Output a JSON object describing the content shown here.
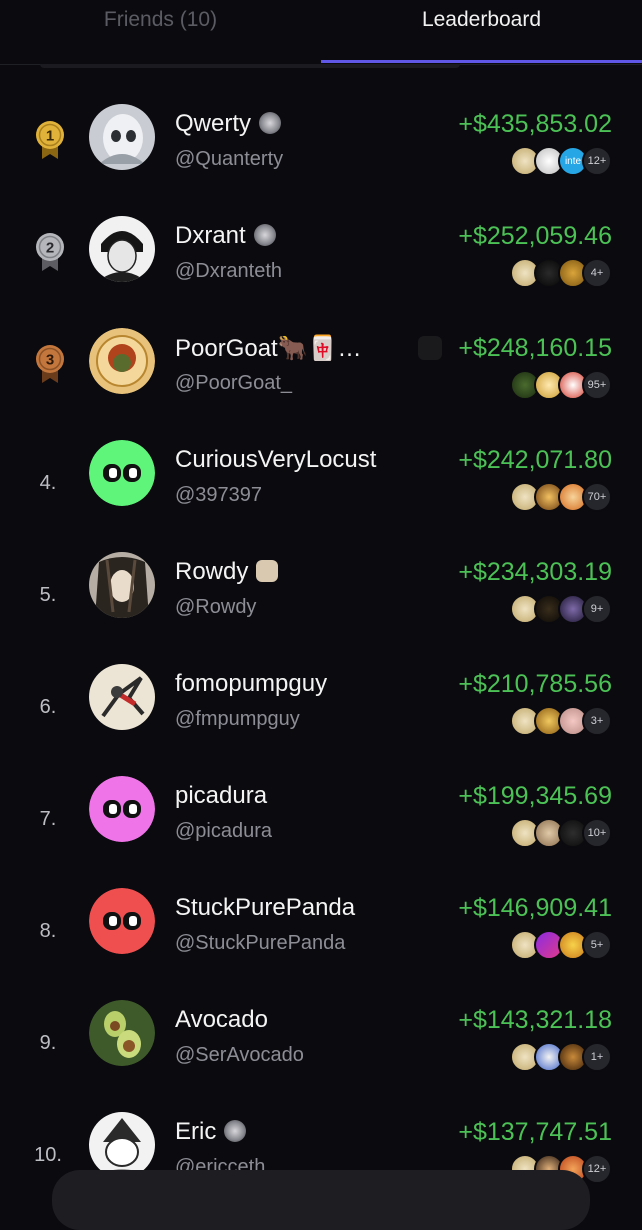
{
  "tabs": {
    "friends": "Friends (10)",
    "leaderboard": "Leaderboard"
  },
  "rows": [
    {
      "rank": "1",
      "name": "Qwerty",
      "handle": "@Quanterty",
      "pnl": "+$435,853.02",
      "more": "12+"
    },
    {
      "rank": "2",
      "name": "Dxrant",
      "handle": "@Dxranteth",
      "pnl": "+$252,059.46",
      "more": "4+"
    },
    {
      "rank": "3",
      "name": "PoorGoat🐂🀄…",
      "handle": "@PoorGoat_",
      "pnl": "+$248,160.15",
      "more": "95+"
    },
    {
      "rank": "4.",
      "name": "CuriousVeryLocust",
      "handle": "@397397",
      "pnl": "+$242,071.80",
      "more": "70+"
    },
    {
      "rank": "5.",
      "name": "Rowdy",
      "handle": "@Rowdy",
      "pnl": "+$234,303.19",
      "more": "9+"
    },
    {
      "rank": "6.",
      "name": "fomopumpguy",
      "handle": "@fmpumpguy",
      "pnl": "+$210,785.56",
      "more": "3+"
    },
    {
      "rank": "7.",
      "name": "picadura",
      "handle": "@picadura",
      "pnl": "+$199,345.69",
      "more": "10+"
    },
    {
      "rank": "8.",
      "name": "StuckPurePanda",
      "handle": "@StuckPurePanda",
      "pnl": "+$146,909.41",
      "more": "5+"
    },
    {
      "rank": "9.",
      "name": "Avocado",
      "handle": "@SerAvocado",
      "pnl": "+$143,321.18",
      "more": "1+"
    },
    {
      "rank": "10.",
      "name": "Eric",
      "handle": "@ericceth",
      "pnl": "+$137,747.51",
      "more": "12+"
    }
  ],
  "colors": {
    "accent": "#6157e6",
    "profit": "#4cc256"
  },
  "token_text": {
    "r0t2": "inte"
  }
}
